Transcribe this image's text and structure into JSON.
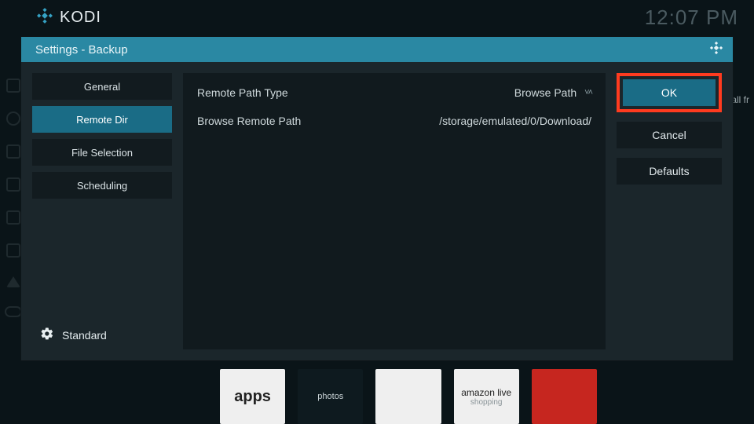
{
  "topbar": {
    "brand": "KODI",
    "clock": "12:07 PM"
  },
  "dialog": {
    "title": "Settings - Backup"
  },
  "sidebar": {
    "items": [
      {
        "label": "General"
      },
      {
        "label": "Remote Dir"
      },
      {
        "label": "File Selection"
      },
      {
        "label": "Scheduling"
      }
    ],
    "level_label": "Standard"
  },
  "settings": {
    "rows": [
      {
        "label": "Remote Path Type",
        "value": "Browse Path"
      },
      {
        "label": "Browse Remote Path",
        "value": "/storage/emulated/0/Download/"
      }
    ]
  },
  "buttons": {
    "ok": "OK",
    "cancel": "Cancel",
    "defaults": "Defaults"
  },
  "bg": {
    "right_text": "all fr",
    "tiles": [
      "apps",
      "photos",
      "",
      "amazon live",
      ""
    ]
  }
}
